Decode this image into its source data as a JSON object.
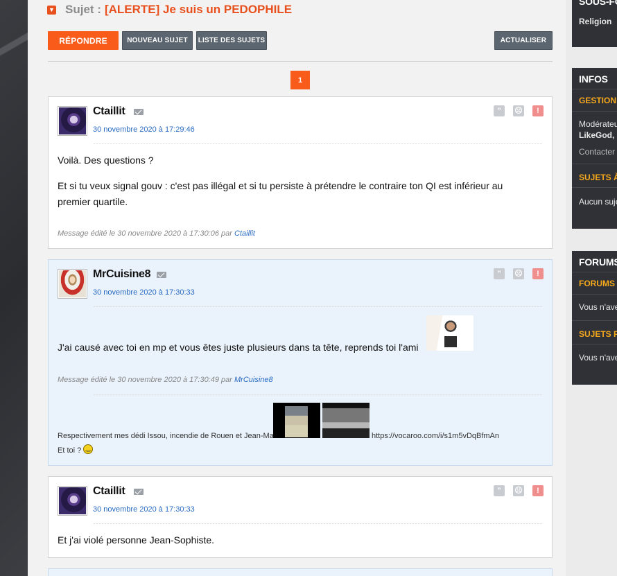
{
  "topic": {
    "prefix": "Sujet :",
    "title": "[ALERTE] Je suis un PEDOPHILE"
  },
  "toolbar": {
    "reply": "RÉPONDRE",
    "new_topic": "NOUVEAU SUJET",
    "topic_list": "LISTE DES SUJETS",
    "refresh": "ACTUALISER"
  },
  "pagination": {
    "current": "1"
  },
  "posts": [
    {
      "author": "Ctaillit",
      "date": "30 novembre 2020 à 17:29:46",
      "paragraphs": [
        "Voilà. Des questions ?",
        "Et si tu veux signal gouv : c'est pas illégal et si tu persiste à prétendre le contraire ton QI est inférieur au",
        "premier quartile."
      ],
      "edit_prefix": "Message édité le 30 novembre 2020 à 17:30:06 par",
      "edit_author": "Ctaillit"
    },
    {
      "author": "MrCuisine8",
      "date": "30 novembre 2020 à 17:30:33",
      "paragraphs": [
        "J'ai causé avec toi en mp et vous êtes juste plusieurs dans ta tête, reprends toi l'ami"
      ],
      "edit_prefix": "Message édité le 30 novembre 2020 à 17:30:49 par",
      "edit_author": "MrCuisine8",
      "signature": {
        "text": "Respectivement mes dédi Issou, incendie de Rouen et Jean-Ma :",
        "link": "https://vocaroo.com/i/s1m5vDqBfmAn",
        "line2": "Et toi ?"
      }
    },
    {
      "author": "Ctaillit",
      "date": "30 novembre 2020 à 17:30:33",
      "paragraphs": [
        "Et j'ai violé personne Jean-Sophiste."
      ]
    }
  ],
  "sidebar": {
    "sous_forums": {
      "title": "SOUS-FORUMS",
      "item": "Religion"
    },
    "infos": {
      "title": "INFOS",
      "gestion": "GESTION DU FORUM",
      "moderators_label": "Modérateurs",
      "moderators": "LikeGod, [",
      "contact": "Contacter les modérateurs",
      "pinned_title": "SUJETS À NE PAS MANQUER",
      "pinned_text": "Aucun sujet à ne pas manquer"
    },
    "forums": {
      "title": "FORUMS",
      "preferes": "FORUMS PRÉFÉRÉS",
      "preferes_text": "Vous n'avez pas",
      "sujets": "SUJETS FAVORIS",
      "sujets_text": "Vous n'avez pas"
    }
  },
  "colors": {
    "accent": "#f85b1a",
    "link": "#2a6bc2",
    "sidebar_sub": "#f6a81c"
  }
}
